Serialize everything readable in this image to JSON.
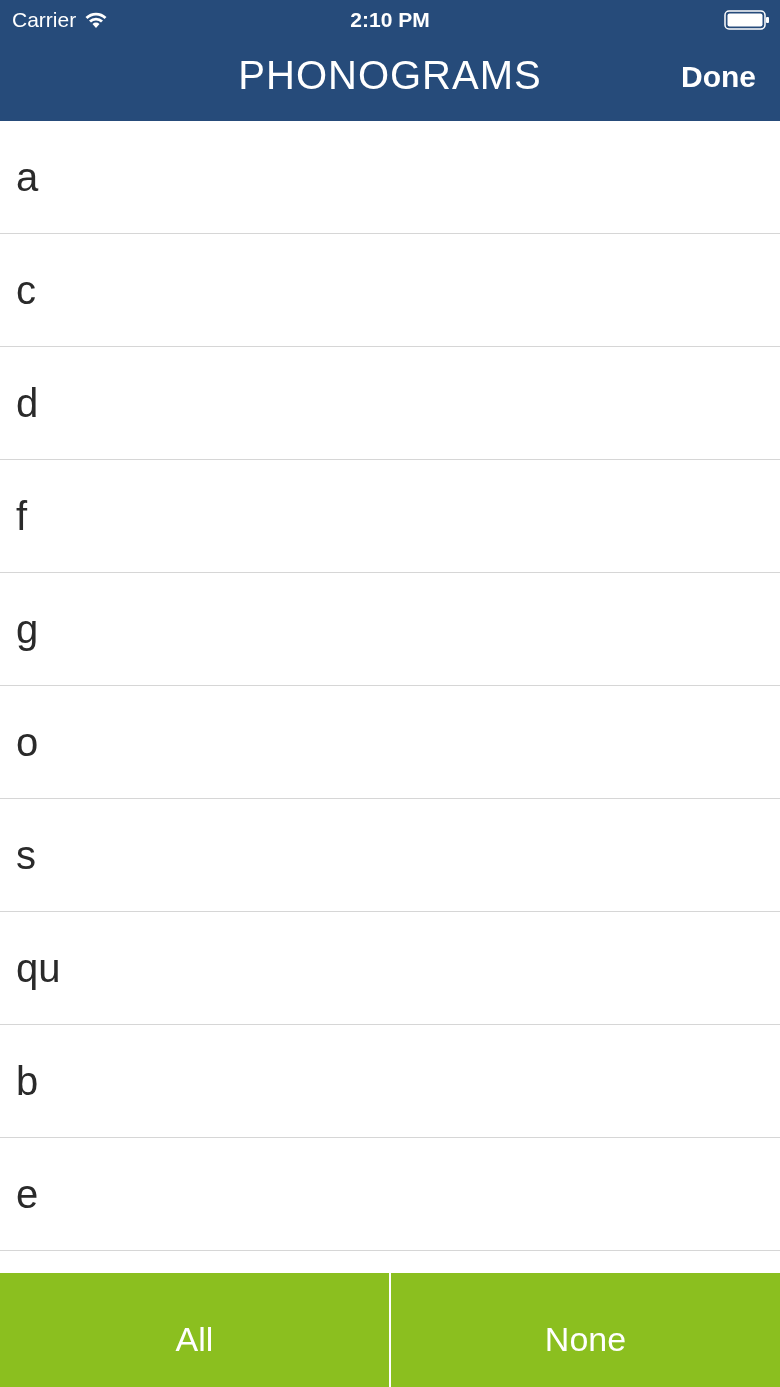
{
  "status_bar": {
    "carrier": "Carrier",
    "time": "2:10 PM"
  },
  "nav_bar": {
    "title": "PHONOGRAMS",
    "done_button": "Done"
  },
  "phonograms": [
    {
      "label": "a"
    },
    {
      "label": "c"
    },
    {
      "label": "d"
    },
    {
      "label": "f"
    },
    {
      "label": "g"
    },
    {
      "label": "o"
    },
    {
      "label": "s"
    },
    {
      "label": "qu"
    },
    {
      "label": "b"
    },
    {
      "label": "e"
    }
  ],
  "bottom_bar": {
    "buttons": [
      "All",
      "None"
    ]
  }
}
